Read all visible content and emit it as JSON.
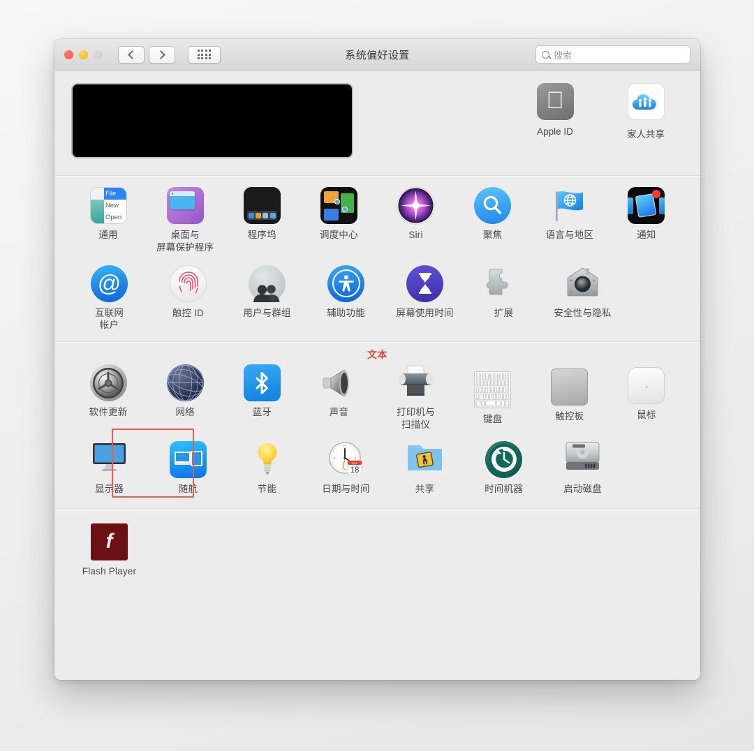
{
  "window": {
    "title": "系统偏好设置",
    "traffic_lights": [
      "close",
      "minimize",
      "zoom"
    ],
    "nav": {
      "back": "back-icon",
      "forward": "forward-icon",
      "grid": "show-all-grid-icon"
    }
  },
  "search": {
    "placeholder": "搜索",
    "value": "",
    "icon": "search-icon"
  },
  "account_section": {
    "redacted": "redacted-account-banner",
    "items": [
      {
        "label": "Apple ID",
        "icon": "apple-logo-icon"
      },
      {
        "label": "家人共享",
        "icon": "family-sharing-cloud-icon"
      }
    ]
  },
  "groups": [
    {
      "name": "personal",
      "rows": [
        [
          {
            "label": "通用",
            "icon": "general-menu-icon"
          },
          {
            "label": "桌面与\n屏幕保护程序",
            "icon": "desktop-screensaver-icon"
          },
          {
            "label": "程序坞",
            "icon": "dock-icon"
          },
          {
            "label": "调度中心",
            "icon": "mission-control-icon"
          },
          {
            "label": "Siri",
            "icon": "siri-icon"
          },
          {
            "label": "聚焦",
            "icon": "spotlight-magnifier-icon"
          },
          {
            "label": "语言与地区",
            "icon": "language-region-flag-icon"
          },
          {
            "label": "通知",
            "icon": "notifications-icon"
          }
        ],
        [
          {
            "label": "互联网\n帐户",
            "icon": "internet-accounts-at-icon"
          },
          {
            "label": "触控 ID",
            "icon": "touch-id-fingerprint-icon"
          },
          {
            "label": "用户与群组",
            "icon": "users-groups-icon"
          },
          {
            "label": "辅助功能",
            "icon": "accessibility-icon"
          },
          {
            "label": "屏幕使用时间",
            "icon": "screen-time-hourglass-icon"
          },
          {
            "label": "扩展",
            "icon": "extensions-puzzle-icon"
          },
          {
            "label": "安全性与隐私",
            "icon": "security-privacy-house-icon"
          }
        ]
      ]
    },
    {
      "name": "hardware",
      "rows": [
        [
          {
            "label": "软件更新",
            "icon": "software-update-gear-icon"
          },
          {
            "label": "网络",
            "icon": "network-globe-icon"
          },
          {
            "label": "蓝牙",
            "icon": "bluetooth-icon"
          },
          {
            "label": "声音",
            "icon": "sound-speaker-icon"
          },
          {
            "label": "打印机与\n扫描仪",
            "icon": "printers-scanners-icon"
          },
          {
            "label": "键盘",
            "icon": "keyboard-icon"
          },
          {
            "label": "触控板",
            "icon": "trackpad-icon"
          },
          {
            "label": "鼠标",
            "icon": "mouse-icon"
          }
        ],
        [
          {
            "label": "显示器",
            "icon": "displays-monitor-icon"
          },
          {
            "label": "随航",
            "icon": "sidecar-icon"
          },
          {
            "label": "节能",
            "icon": "energy-saver-bulb-icon"
          },
          {
            "label": "日期与时间",
            "icon": "date-time-clock-icon"
          },
          {
            "label": "共享",
            "icon": "sharing-folder-icon"
          },
          {
            "label": "时间机器",
            "icon": "time-machine-icon"
          },
          {
            "label": "启动磁盘",
            "icon": "startup-disk-icon"
          }
        ]
      ]
    },
    {
      "name": "third-party",
      "rows": [
        [
          {
            "label": "Flash Player",
            "icon": "flash-player-icon"
          }
        ]
      ]
    }
  ],
  "annotation": {
    "label": "文本",
    "color": "#e8483f",
    "highlight_target": "软件更新",
    "highlight_color": "#f05a52"
  },
  "date_icon": {
    "month": "JUL",
    "day": "18"
  }
}
